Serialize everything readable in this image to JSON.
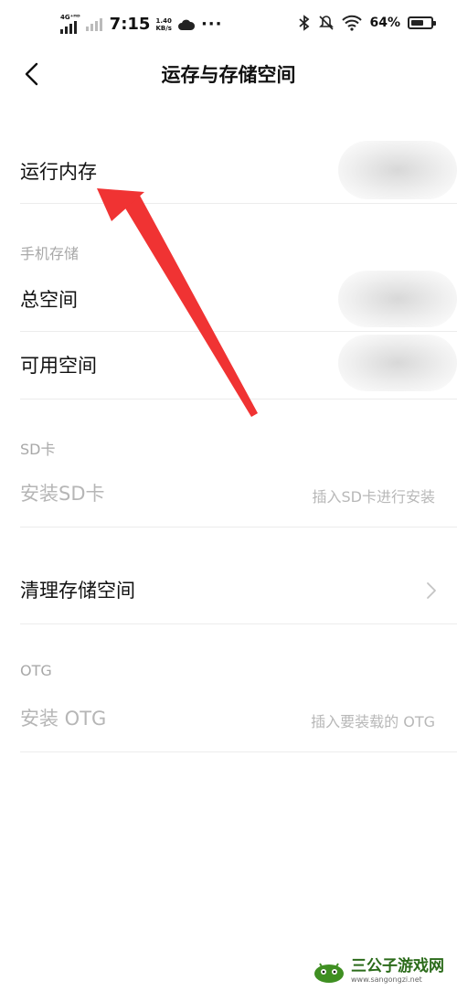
{
  "status_bar": {
    "network_type": "4G⁺ᴴᴰ",
    "time": "7:15",
    "speed_value": "1.40",
    "speed_unit": "KB/s",
    "more": "···",
    "battery_percent": "64%",
    "battery_level": 0.64
  },
  "header": {
    "title": "运存与存储空间"
  },
  "rows": {
    "ram": {
      "label": "运行内存"
    },
    "total": {
      "label": "总空间"
    },
    "available": {
      "label": "可用空间"
    },
    "install_sd": {
      "label": "安装SD卡",
      "value": "插入SD卡进行安装"
    },
    "clean": {
      "label": "清理存储空间"
    },
    "install_otg": {
      "label": "安装 OTG",
      "value": "插入要装载的 OTG"
    }
  },
  "sections": {
    "phone_storage": "手机存储",
    "sd": "SD卡",
    "otg": "OTG"
  },
  "colors": {
    "annotation_arrow": "#f03333",
    "watermark_green": "#2b6b1a"
  },
  "watermark": {
    "name": "三公子游戏网",
    "url": "www.sangongzi.net"
  }
}
